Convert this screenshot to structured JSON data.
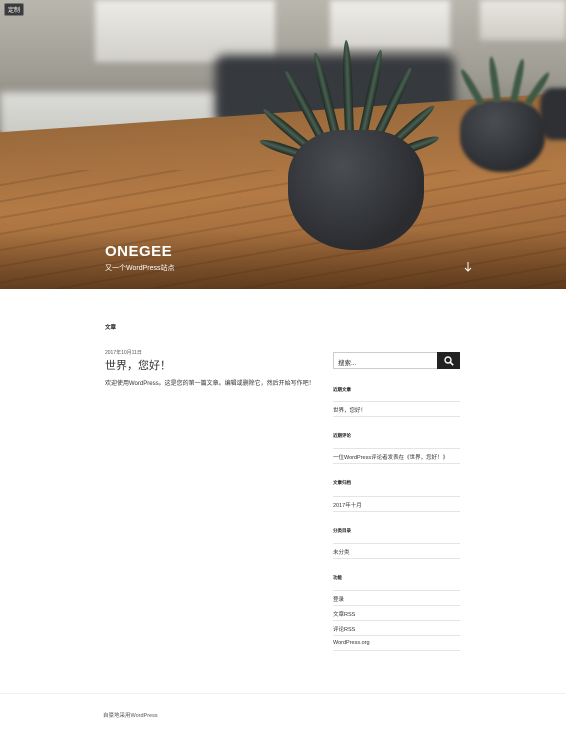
{
  "admin": {
    "edit_label": "定制"
  },
  "header": {
    "site_title": "ONEGEE",
    "site_description": "又一个WordPress站点",
    "scroll_icon": "arrow-down-icon"
  },
  "main": {
    "section_label": "文章",
    "post": {
      "date": "2017年10月11日",
      "title": "世界，您好！",
      "body": "欢迎使用WordPress。这是您的第一篇文章。编辑或删除它，然后开始写作吧！"
    }
  },
  "sidebar": {
    "search": {
      "placeholder": "搜索...",
      "icon": "search-icon"
    },
    "widgets": [
      {
        "title": "近期文章",
        "items": [
          "世界，您好！"
        ]
      },
      {
        "title": "近期评论",
        "items": [
          "一位WordPress评论者发表在《世界，您好！》"
        ]
      },
      {
        "title": "文章归档",
        "items": [
          "2017年十月"
        ]
      },
      {
        "title": "分类目录",
        "items": [
          "未分类"
        ]
      },
      {
        "title": "功能",
        "items": [
          "登录",
          "文章RSS",
          "评论RSS",
          "WordPress.org"
        ]
      }
    ]
  },
  "footer": {
    "credit": "自豪地采用WordPress"
  }
}
